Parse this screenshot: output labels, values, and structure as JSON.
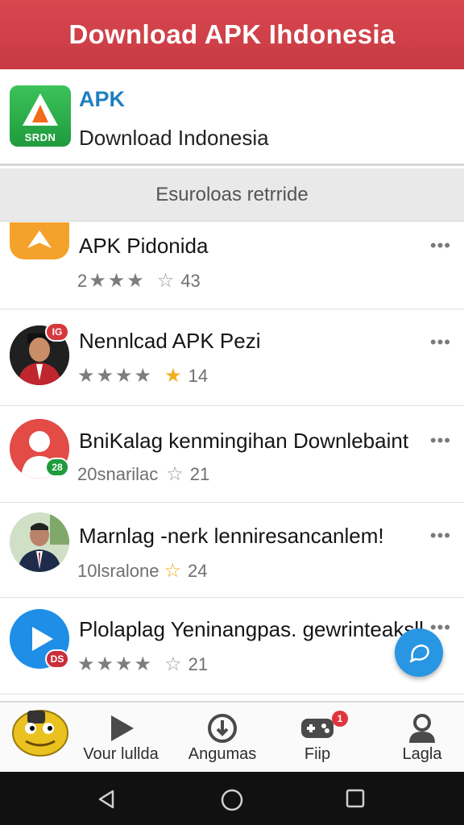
{
  "topbar": {
    "title": "Download APK Ihdonesia"
  },
  "app": {
    "logo_text": "SRDN",
    "name": "APK",
    "subtitle": "Download Indonesia"
  },
  "section": {
    "title": "Esuroloas retrride"
  },
  "items": [
    {
      "title": "APK Pidonida",
      "rating_prefix": "2",
      "count": "43",
      "more": "•••"
    },
    {
      "title": "Nennlcad APK Pezi",
      "badge": "IG",
      "count": "14",
      "more": "•••"
    },
    {
      "title": "BniKalag kenmingihan Downlebaint",
      "badge": "28",
      "rating_prefix": "20snarilac",
      "count": "21",
      "more": "•••"
    },
    {
      "title": "Marnlag -nerk lenniresancanlem!",
      "rating_prefix": "10lsralone",
      "count": "24",
      "more": "•••"
    },
    {
      "title": "Plolaplag Yeninangpas. gewrinteaksll",
      "badge": "DS",
      "count": "21",
      "more": "•••"
    }
  ],
  "nav": [
    {
      "label": ""
    },
    {
      "label": "Vour lullda"
    },
    {
      "label": "Angumas"
    },
    {
      "label": "Fiip",
      "badge": "1"
    },
    {
      "label": "Lagla"
    }
  ],
  "colors": {
    "brand_red": "#d9474f",
    "accent_blue": "#1f7fc1",
    "fab_blue": "#2996e3",
    "star_gold": "#f2b01e"
  },
  "icons": {
    "fab": "chat-bubble-icon",
    "nav": [
      "emoji-face-icon",
      "play-icon",
      "download-circle-icon",
      "gamepad-icon",
      "person-icon"
    ],
    "system": [
      "back-icon",
      "home-icon",
      "recents-icon"
    ]
  }
}
